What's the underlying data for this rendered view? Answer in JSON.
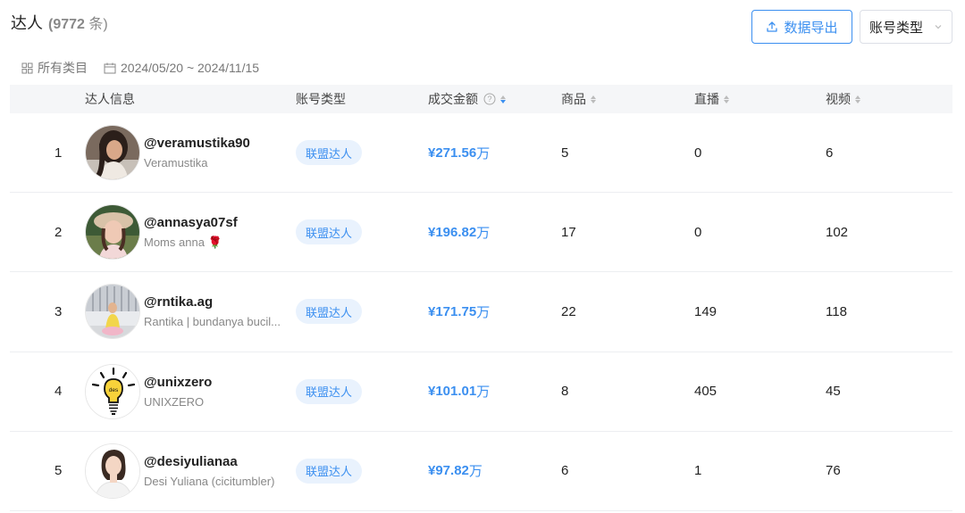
{
  "header": {
    "title": "达人",
    "count_open": "(",
    "count_num": "9772",
    "count_unit": " 条)",
    "export_label": "数据导出",
    "type_select_label": "账号类型"
  },
  "filters": {
    "category": "所有类目",
    "date_range": "2024/05/20 ~ 2024/11/15"
  },
  "columns": {
    "creator_info": "达人信息",
    "account_type": "账号类型",
    "gmv": "成交金额",
    "goods": "商品",
    "live": "直播",
    "video": "视频"
  },
  "rows": [
    {
      "rank": "1",
      "handle": "@veramustika90",
      "nickname": "Veramustika",
      "type": "联盟达人",
      "gmv": "¥271.56",
      "gmv_unit": "万",
      "goods": "5",
      "live": "0",
      "video": "6",
      "avatar": "woman-portrait"
    },
    {
      "rank": "2",
      "handle": "@annasya07sf",
      "nickname": "Moms anna 🌹",
      "type": "联盟达人",
      "gmv": "¥196.82",
      "gmv_unit": "万",
      "goods": "17",
      "live": "0",
      "video": "102",
      "avatar": "woman-hat"
    },
    {
      "rank": "3",
      "handle": "@rntika.ag",
      "nickname": "Rantika | bundanya bucil...",
      "type": "联盟达人",
      "gmv": "¥171.75",
      "gmv_unit": "万",
      "goods": "22",
      "live": "149",
      "video": "118",
      "avatar": "child-building"
    },
    {
      "rank": "4",
      "handle": "@unixzero",
      "nickname": "UNIXZERO",
      "type": "联盟达人",
      "gmv": "¥101.01",
      "gmv_unit": "万",
      "goods": "8",
      "live": "405",
      "video": "45",
      "avatar": "lightbulb-logo"
    },
    {
      "rank": "5",
      "handle": "@desiyulianaa",
      "nickname": "Desi Yuliana (cicitumbler)",
      "type": "联盟达人",
      "gmv": "¥97.82",
      "gmv_unit": "万",
      "goods": "6",
      "live": "1",
      "video": "76",
      "avatar": "woman-white"
    }
  ],
  "colors": {
    "accent": "#3b8ff0",
    "tag_bg": "#e9f2fd",
    "header_bg": "#f5f6f8"
  }
}
